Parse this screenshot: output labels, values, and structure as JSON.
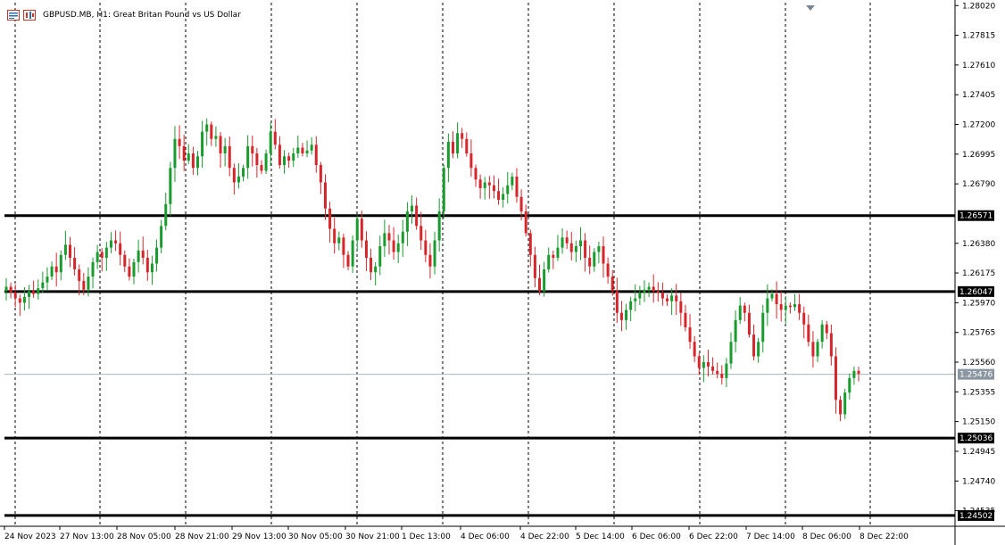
{
  "window": {
    "symbol": "GBPUSD.MB",
    "timeframe": "H1",
    "description": "Great Britan Pound vs US Dollar",
    "title_text": "GBPUSD.MB, H1:  Great Britan Pound vs US Dollar"
  },
  "header_icons": [
    "chart-window-icon",
    "chart-window-alt-icon"
  ],
  "colors": {
    "bull": "#1a9b2e",
    "bear": "#d6262b",
    "grid": "#000000",
    "level_line": "#000000",
    "current_price_line": "#a9b4bd",
    "current_price_tag_bg": "#8a96a0",
    "level_tag_bg": "#000000",
    "level_tag_text": "#ffffff"
  },
  "price_axis": {
    "ticks": [
      "1.28020",
      "1.27815",
      "1.27610",
      "1.27405",
      "1.27200",
      "1.26995",
      "1.26790",
      "1.26380",
      "1.26175",
      "1.25970",
      "1.25765",
      "1.25560",
      "1.25355",
      "1.25150",
      "1.24945",
      "1.24740",
      "1.24535"
    ],
    "min": 1.2444,
    "max": 1.2804
  },
  "levels": [
    {
      "price": 1.26571,
      "label": "1.26571"
    },
    {
      "price": 1.26047,
      "label": "1.26047"
    },
    {
      "price": 1.25036,
      "label": "1.25036"
    },
    {
      "price": 1.24502,
      "label": "1.24502"
    }
  ],
  "current_price": {
    "price": 1.25476,
    "label": "1.25476"
  },
  "time_axis": {
    "labels": [
      "24 Nov 2023",
      "27 Nov 13:00",
      "28 Nov 05:00",
      "28 Nov 21:00",
      "29 Nov 13:00",
      "30 Nov 05:00",
      "30 Nov 21:00",
      "1 Dec 13:00",
      "4 Dec 06:00",
      "4 Dec 22:00",
      "5 Dec 14:00",
      "6 Dec 06:00",
      "6 Dec 22:00",
      "7 Dec 14:00",
      "8 Dec 06:00",
      "8 Dec 22:00"
    ]
  },
  "chart_data": {
    "type": "candlestick",
    "title": "GBPUSD.MB, H1:  Great Britan Pound vs US Dollar",
    "xlabel": "",
    "ylabel": "",
    "ylim": [
      1.2444,
      1.2804
    ],
    "grid": true,
    "candles_note": "hourly OHLC approximations read from chart",
    "close_path": [
      1.2608,
      1.2604,
      1.26,
      1.2597,
      1.2601,
      1.2605,
      1.2603,
      1.2607,
      1.2611,
      1.2615,
      1.2622,
      1.2618,
      1.263,
      1.2637,
      1.2628,
      1.262,
      1.2612,
      1.2606,
      1.2615,
      1.2625,
      1.2632,
      1.2628,
      1.2635,
      1.264,
      1.2638,
      1.263,
      1.2622,
      1.2615,
      1.2625,
      1.2633,
      1.2628,
      1.2618,
      1.2624,
      1.2635,
      1.265,
      1.2665,
      1.269,
      1.271,
      1.2705,
      1.2695,
      1.27,
      1.269,
      1.2698,
      1.2715,
      1.272,
      1.271,
      1.2712,
      1.27,
      1.2705,
      1.269,
      1.268,
      1.2684,
      1.269,
      1.2705,
      1.27,
      1.2692,
      1.2688,
      1.27,
      1.2715,
      1.2706,
      1.2692,
      1.2698,
      1.2695,
      1.27,
      1.2704,
      1.27,
      1.2702,
      1.2706,
      1.2692,
      1.268,
      1.2662,
      1.2648,
      1.2638,
      1.2642,
      1.263,
      1.2622,
      1.264,
      1.2655,
      1.264,
      1.2628,
      1.2618,
      1.2622,
      1.2636,
      1.2645,
      1.264,
      1.2632,
      1.2638,
      1.2646,
      1.266,
      1.2664,
      1.265,
      1.264,
      1.263,
      1.2622,
      1.264,
      1.266,
      1.269,
      1.2708,
      1.27,
      1.2714,
      1.271,
      1.27,
      1.269,
      1.2682,
      1.2676,
      1.268,
      1.2678,
      1.2674,
      1.2668,
      1.2672,
      1.2678,
      1.2684,
      1.267,
      1.266,
      1.2645,
      1.263,
      1.2614,
      1.2605,
      1.262,
      1.263,
      1.2628,
      1.2635,
      1.2642,
      1.2638,
      1.2632,
      1.2636,
      1.264,
      1.2628,
      1.2622,
      1.2632,
      1.2636,
      1.2624,
      1.2615,
      1.2605,
      1.259,
      1.2585,
      1.2592,
      1.2598,
      1.26,
      1.2604,
      1.2606,
      1.2608,
      1.2605,
      1.2604,
      1.26,
      1.2598,
      1.2602,
      1.2598,
      1.259,
      1.258,
      1.257,
      1.256,
      1.2552,
      1.2556,
      1.2553,
      1.255,
      1.2548,
      1.2545,
      1.2555,
      1.257,
      1.2585,
      1.2595,
      1.259,
      1.2575,
      1.256,
      1.257,
      1.259,
      1.26,
      1.2603,
      1.2596,
      1.2592,
      1.2595,
      1.2594,
      1.2596,
      1.259,
      1.2582,
      1.257,
      1.256,
      1.257,
      1.2582,
      1.2576,
      1.256,
      1.253,
      1.252,
      1.2535,
      1.2545,
      1.255,
      1.2548
    ]
  }
}
